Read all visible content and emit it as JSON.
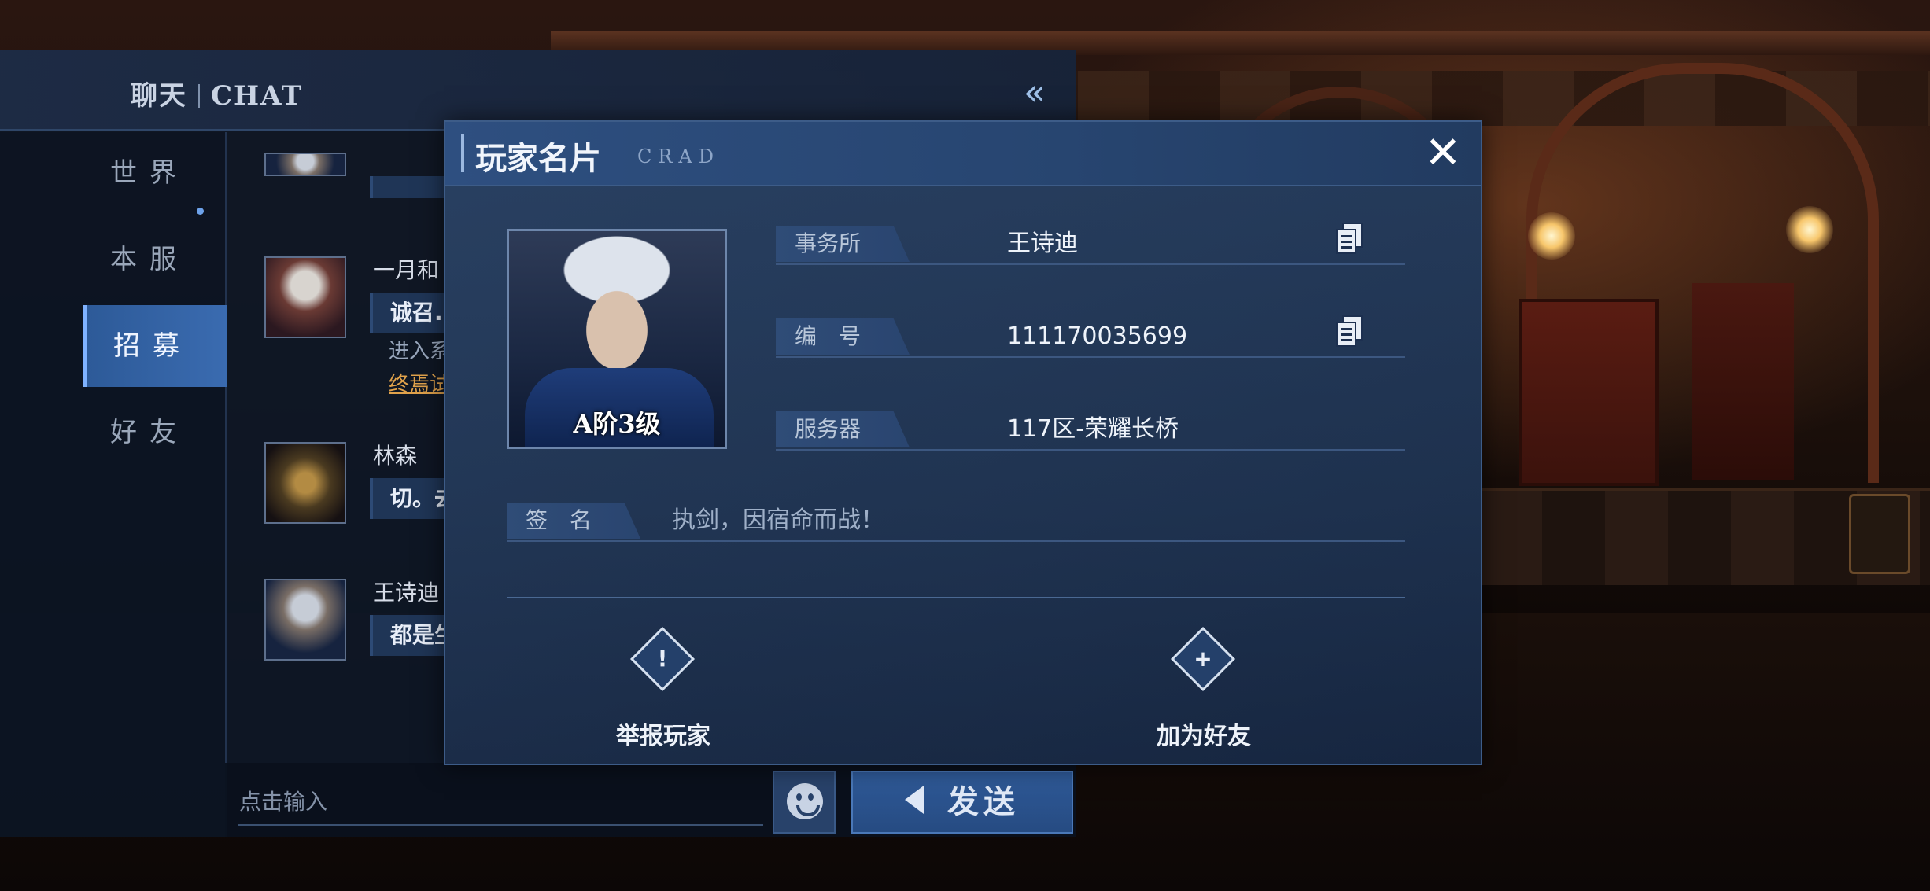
{
  "chat": {
    "title_cn": "聊天",
    "title_en": "CHAT",
    "tabs": [
      {
        "label": "世界"
      },
      {
        "label": "本服"
      },
      {
        "label": "招募"
      },
      {
        "label": "好友"
      }
    ],
    "messages": [
      {
        "name": "一月和",
        "bubble": "诚召...",
        "line1": "进入系",
        "line2": "终焉试"
      },
      {
        "name": "林森",
        "bubble": "切。去"
      },
      {
        "name": "王诗迪",
        "bubble": "都是生"
      }
    ],
    "input_placeholder": "点击输入",
    "send_label": "发送"
  },
  "card": {
    "title": "玩家名片",
    "subtitle": "CRAD",
    "rank": "A阶3级",
    "rows": [
      {
        "label": "事务所",
        "value": "王诗迪"
      },
      {
        "label": "编　号",
        "value": "111170035699"
      },
      {
        "label": "服务器",
        "value": "117区-荣耀长桥"
      }
    ],
    "signature_label": "签　名",
    "signature": "执剑，因宿命而战！",
    "report_label": "举报玩家",
    "add_friend_label": "加为好友"
  },
  "colors": {
    "panel": "#1b2e4a",
    "accent": "#3a6bb0",
    "link": "#e0a24b"
  },
  "icons": {
    "close": "close-icon",
    "copy": "copy-icon",
    "report": "report-icon",
    "add_friend": "add-friend-icon",
    "emoji": "emoji-icon",
    "speaker": "speaker-icon",
    "collapse": "double-chevron-left-icon"
  }
}
